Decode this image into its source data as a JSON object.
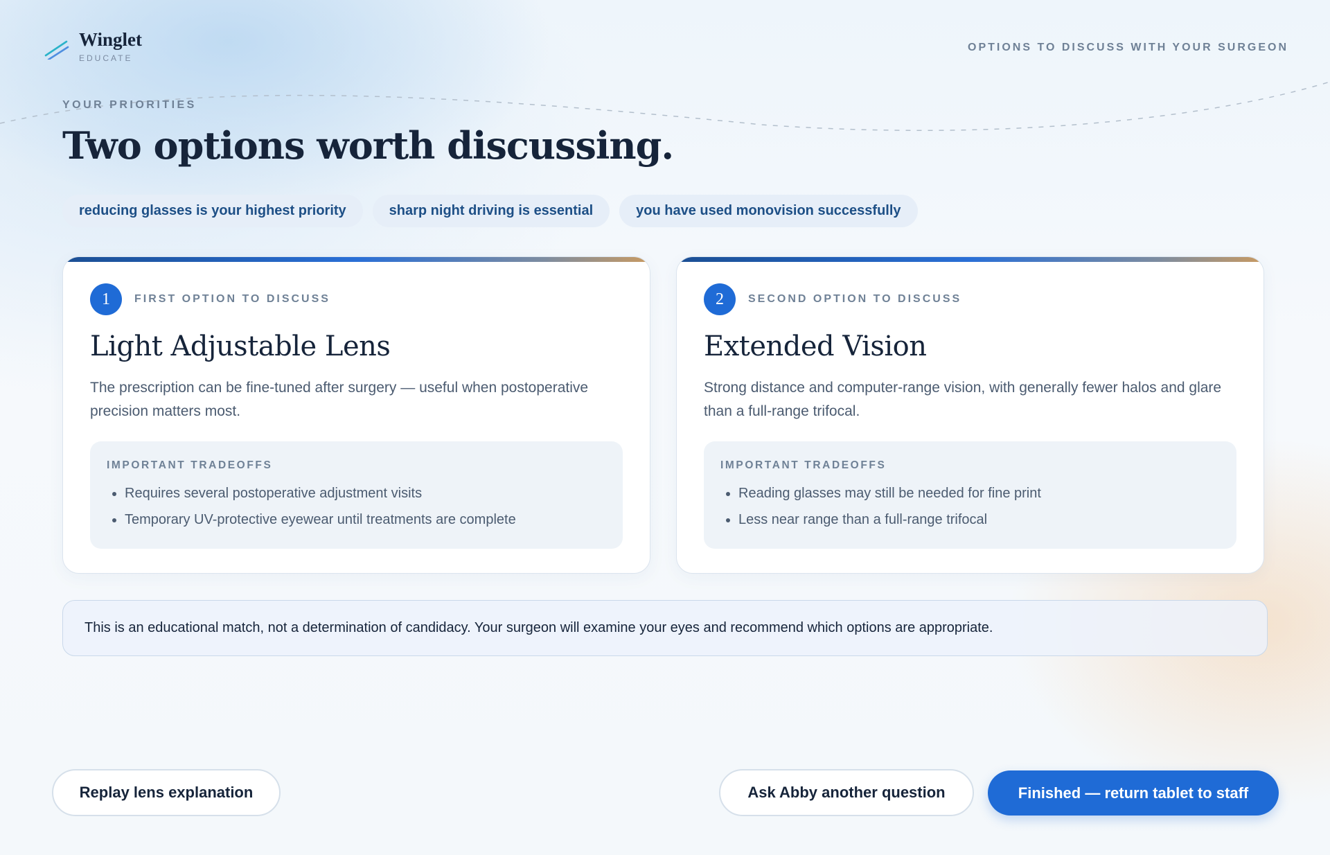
{
  "brand": {
    "name": "Winglet",
    "subtitle": "EDUCATE",
    "icon": "winglet-logo-icon"
  },
  "header": {
    "right_label": "OPTIONS TO DISCUSS WITH YOUR SURGEON"
  },
  "hero": {
    "eyebrow": "YOUR PRIORITIES",
    "title": "Two options worth discussing.",
    "chips": [
      "reducing glasses is your highest priority",
      "sharp night driving is essential",
      "you have used monovision successfully"
    ]
  },
  "options": [
    {
      "number": "1",
      "eyebrow": "FIRST OPTION TO DISCUSS",
      "title": "Light Adjustable Lens",
      "description": "The prescription can be fine-tuned after surgery — useful when postoperative precision matters most.",
      "tradeoffs_title": "IMPORTANT TRADEOFFS",
      "tradeoffs": [
        "Requires several postoperative adjustment visits",
        "Temporary UV-protective eyewear until treatments are complete"
      ]
    },
    {
      "number": "2",
      "eyebrow": "SECOND OPTION TO DISCUSS",
      "title": "Extended Vision",
      "description": "Strong distance and computer-range vision, with generally fewer halos and glare than a full-range trifocal.",
      "tradeoffs_title": "IMPORTANT TRADEOFFS",
      "tradeoffs": [
        "Reading glasses may still be needed for fine print",
        "Less near range than a full-range trifocal"
      ]
    }
  ],
  "notice": {
    "text": "This is an educational match, not a determination of candidacy. Your surgeon will examine your eyes and recommend which options are appropriate."
  },
  "footer": {
    "replay_label": "Replay lens explanation",
    "ask_label": "Ask Abby another question",
    "finish_label": "Finished — return tablet to staff"
  },
  "colors": {
    "accent": "#1f6bd6",
    "chip_bg": "#e6eef8",
    "chip_text": "#1d4f86",
    "heading": "#16243a",
    "muted": "#6f8196"
  }
}
